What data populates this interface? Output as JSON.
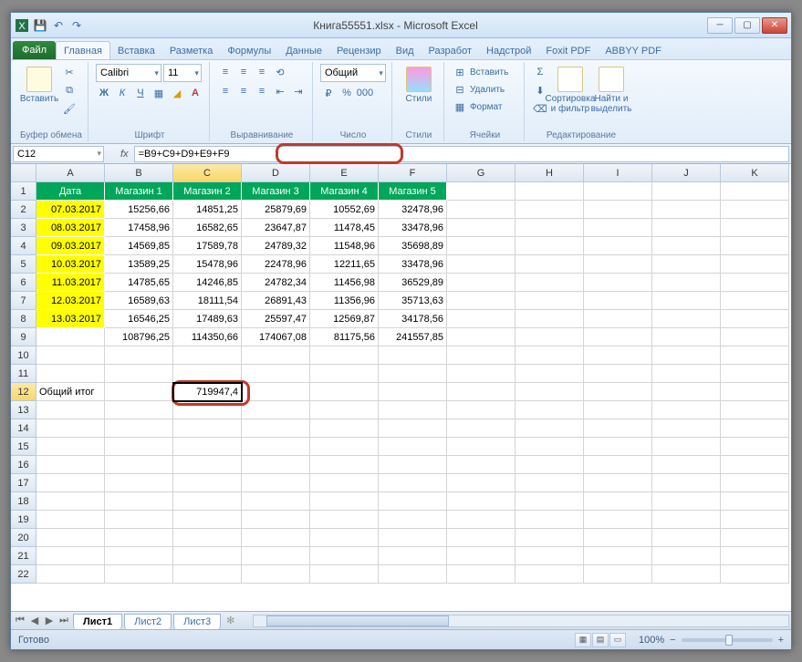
{
  "title": "Книга55551.xlsx - Microsoft Excel",
  "tabs": {
    "file": "Файл",
    "home": "Главная",
    "insert": "Вставка",
    "layout": "Разметка",
    "formulas": "Формулы",
    "data": "Данные",
    "review": "Рецензир",
    "view": "Вид",
    "dev": "Разработ",
    "add": "Надстрой",
    "foxit": "Foxit PDF",
    "abbyy": "ABBYY PDF"
  },
  "groups": {
    "clipboard": "Буфер обмена",
    "font": "Шрифт",
    "align": "Выравнивание",
    "number": "Число",
    "styles": "Стили",
    "cells": "Ячейки",
    "editing": "Редактирование"
  },
  "btns": {
    "paste": "Вставить",
    "styles": "Стили",
    "sort": "Сортировка и фильтр",
    "find": "Найти и выделить",
    "insert": "Вставить",
    "delete": "Удалить",
    "format": "Формат"
  },
  "font": {
    "name": "Calibri",
    "size": "11"
  },
  "numfmt": "Общий",
  "namebox": "C12",
  "formula": "=B9+C9+D9+E9+F9",
  "cols": [
    "A",
    "B",
    "C",
    "D",
    "E",
    "F",
    "G",
    "H",
    "I",
    "J",
    "K"
  ],
  "headers": [
    "Дата",
    "Магазин 1",
    "Магазин 2",
    "Магазин 3",
    "Магазин 4",
    "Магазин 5"
  ],
  "rows": [
    [
      "07.03.2017",
      "15256,66",
      "14851,25",
      "25879,69",
      "10552,69",
      "32478,96"
    ],
    [
      "08.03.2017",
      "17458,96",
      "16582,65",
      "23647,87",
      "11478,45",
      "33478,96"
    ],
    [
      "09.03.2017",
      "14569,85",
      "17589,78",
      "24789,32",
      "11548,96",
      "35698,89"
    ],
    [
      "10.03.2017",
      "13589,25",
      "15478,96",
      "22478,96",
      "12211,65",
      "33478,96"
    ],
    [
      "11.03.2017",
      "14785,65",
      "14246,85",
      "24782,34",
      "11456,98",
      "36529,89"
    ],
    [
      "12.03.2017",
      "16589,63",
      "18111,54",
      "26891,43",
      "11356,96",
      "35713,63"
    ],
    [
      "13.03.2017",
      "16546,25",
      "17489,63",
      "25597,47",
      "12569,87",
      "34178,56"
    ]
  ],
  "totals": [
    "",
    "108796,25",
    "114350,66",
    "174067,08",
    "81175,56",
    "241557,85"
  ],
  "grand_label": "Общий итог",
  "grand_value": "719947,4",
  "sheets": [
    "Лист1",
    "Лист2",
    "Лист3"
  ],
  "status": "Готово",
  "zoom": "100%"
}
